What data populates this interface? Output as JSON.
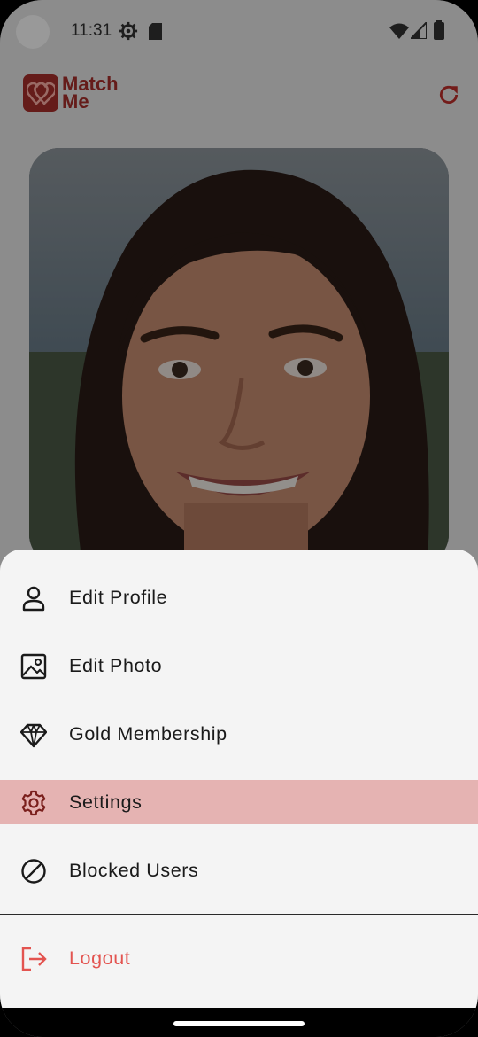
{
  "status_bar": {
    "time": "11:31",
    "icons": [
      "settings-gear-icon",
      "sd-card-icon",
      "wifi-icon",
      "signal-icon",
      "battery-icon"
    ]
  },
  "app": {
    "logo_line1": "Match",
    "logo_line2": "Me",
    "brand_color": "#a8302c",
    "refresh_icon": "refresh-icon"
  },
  "menu": {
    "items": [
      {
        "label": "Edit Profile",
        "icon": "person-icon",
        "selected": false
      },
      {
        "label": "Edit Photo",
        "icon": "image-icon",
        "selected": false
      },
      {
        "label": "Gold Membership",
        "icon": "diamond-icon",
        "selected": false
      },
      {
        "label": "Settings",
        "icon": "gear-icon",
        "selected": true
      },
      {
        "label": "Blocked Users",
        "icon": "block-icon",
        "selected": false
      }
    ],
    "logout": {
      "label": "Logout",
      "icon": "logout-icon",
      "color": "#e35450"
    },
    "selected_color": "#e5b3b2"
  }
}
